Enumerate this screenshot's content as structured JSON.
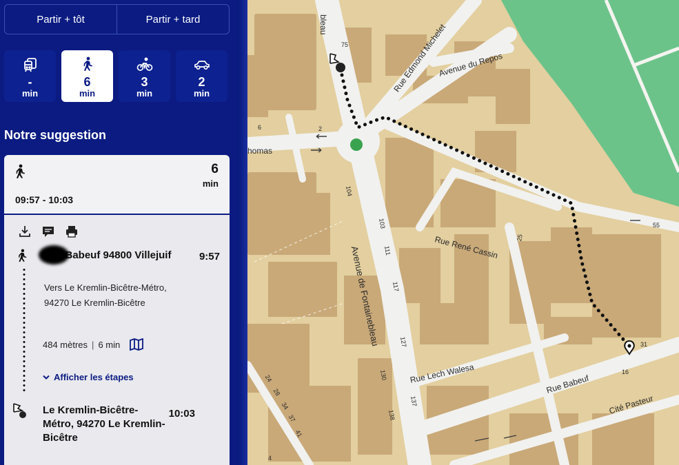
{
  "time_switch": {
    "earlier": "Partir + tôt",
    "later": "Partir + tard"
  },
  "modes": [
    {
      "icon": "transit-icon",
      "value": "-",
      "unit": "min"
    },
    {
      "icon": "walk-icon",
      "value": "6",
      "unit": "min"
    },
    {
      "icon": "bike-icon",
      "value": "3",
      "unit": "min"
    },
    {
      "icon": "car-icon",
      "value": "2",
      "unit": "min"
    }
  ],
  "suggestion": {
    "title": "Notre suggestion",
    "duration_value": "6",
    "duration_unit": "min",
    "hours": "09:57 - 10:03"
  },
  "itinerary": {
    "origin_name": "Rue Babeuf 94800 Villejuif",
    "origin_time": "9:57",
    "towards": "Vers Le Kremlin-Bicêtre-Métro, 94270 Le Kremlin-Bicêtre",
    "distance": "484 mètres",
    "separator": "|",
    "duration": "6 min",
    "steps_label": "Afficher les étapes",
    "destination_name": "Le Kremlin-Bicêtre-Métro, 94270 Le Kremlin-Bicêtre",
    "destination_time": "10:03"
  },
  "map": {
    "labels": {
      "fontainebleau_top": "bleau",
      "michelet": "Rue Edmond Michelet",
      "repos": "Avenue du Repos",
      "thomas": "homas",
      "fontainebleau": "Avenue de Fontainebleau",
      "cassin": "Rue René Cassin",
      "walesa": "Rue Lech Walesa",
      "babeuf": "Rue Babeuf",
      "pasteur": "Cité Pasteur"
    },
    "numbers": [
      "75",
      "6",
      "2",
      "104",
      "103",
      "111",
      "117",
      "127",
      "130",
      "137",
      "138",
      "25",
      "31",
      "55",
      "16",
      "24",
      "28",
      "34",
      "37",
      "41",
      "4"
    ],
    "colors": {
      "land": "#e3cf9f",
      "building": "#c9a978",
      "road": "#f1f1ef",
      "park": "#6cc38a",
      "route": "#111111"
    }
  }
}
